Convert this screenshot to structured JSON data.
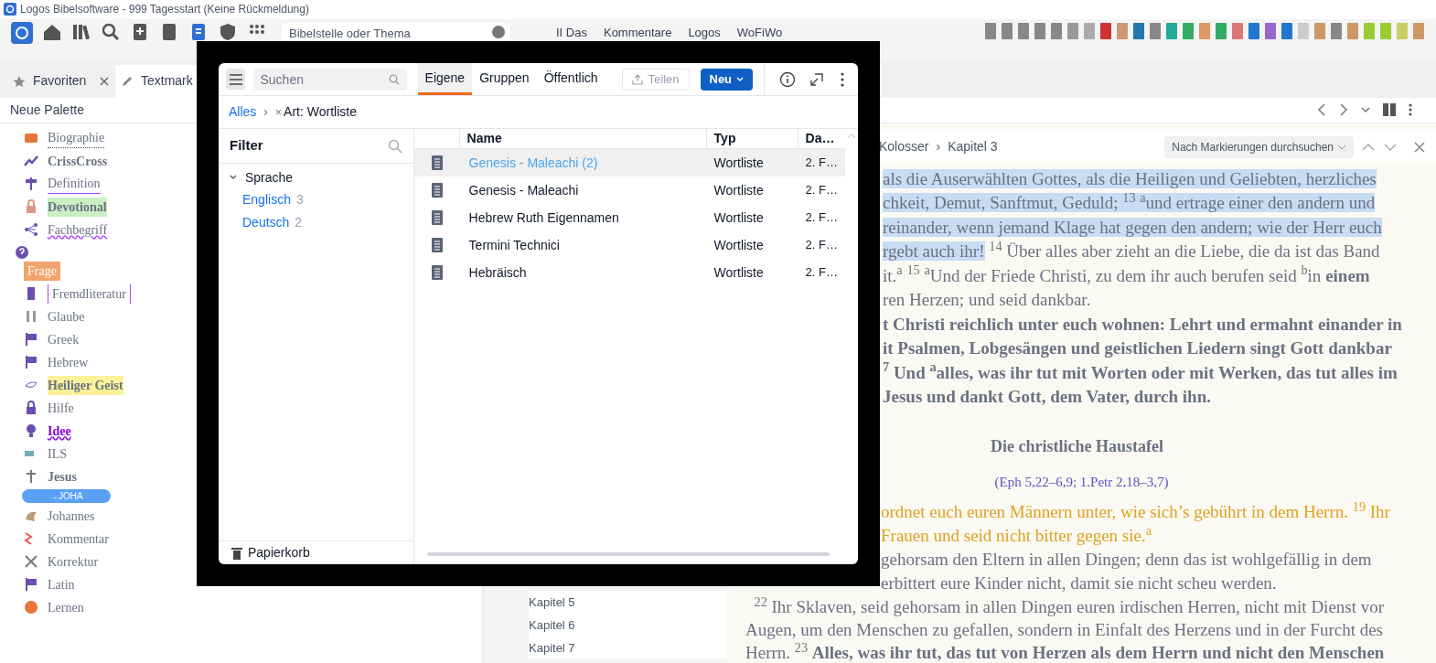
{
  "window": {
    "title": "Logos Bibelsoftware - 999 Tagesstart (Keine Rückmeldung)"
  },
  "toolbar": {
    "search": {
      "placeholder": "Bibelstelle oder Thema"
    },
    "menus": [
      "II Das",
      "Kommentare",
      "Logos",
      "WoFiWo"
    ]
  },
  "tabs": [
    {
      "label": "Favoriten",
      "closable": true
    },
    {
      "label": "Textmark",
      "closable": false
    }
  ],
  "palette": {
    "title": "Neue Palette",
    "items": [
      {
        "label": "Biographie",
        "kind": "dotted"
      },
      {
        "label": "CrissCross",
        "kind": "bold"
      },
      {
        "label": "Definition",
        "kind": "underline"
      },
      {
        "label": "Devotional",
        "kind": "highlight",
        "color": "#c9efc2"
      },
      {
        "label": "Fachbegriff",
        "kind": "wavy"
      },
      {
        "label": "Frage",
        "kind": "badge",
        "color": "#f3a46e"
      },
      {
        "label": "Fremdliteratur",
        "kind": "bracket"
      },
      {
        "label": "Glaube",
        "kind": "plain"
      },
      {
        "label": "Greek",
        "kind": "plain"
      },
      {
        "label": "Hebrew",
        "kind": "plain"
      },
      {
        "label": "Heiliger Geist",
        "kind": "highlight",
        "color": "#fbf29a"
      },
      {
        "label": "Hilfe",
        "kind": "plain"
      },
      {
        "label": "Idee",
        "kind": "link"
      },
      {
        "label": "ILS",
        "kind": "plain"
      },
      {
        "label": "Jesus",
        "kind": "bold"
      },
      {
        "label": "Johannes",
        "kind": "plain",
        "tag": "→JOHA"
      },
      {
        "label": "Kommentar",
        "kind": "plain"
      },
      {
        "label": "Korrektur",
        "kind": "plain"
      },
      {
        "label": "Latin",
        "kind": "plain"
      },
      {
        "label": "Lernen",
        "kind": "plain"
      }
    ]
  },
  "chapters": [
    "Kapitel 5",
    "Kapitel 6",
    "Kapitel 7"
  ],
  "reader": {
    "breadcrumb": [
      "Kolosser",
      "Kapitel 3"
    ],
    "breadcrumb_separator": "›",
    "search_dropdown": "Nach Markierungen durchsuchen",
    "upper_lines": [
      {
        "kind": "normal",
        "segments": [
          {
            "text": "als die Auserwählten Gottes, als die Heiligen und Geliebten, herzliches",
            "highlighted": true
          }
        ]
      },
      {
        "kind": "normal",
        "segments": [
          {
            "text": "chkeit, Demut, Sanftmut, Geduld; $^{13}$ $^{a}$und ertrage einer den andern und",
            "highlighted": true
          }
        ]
      },
      {
        "kind": "normal",
        "segments": [
          {
            "text": "reinander, wenn jemand Klage hat gegen den andern; wie der Herr euch",
            "highlighted": true
          }
        ]
      },
      {
        "kind": "normal",
        "segments": [
          {
            "text": "rgebt auch ihr!",
            "highlighted": true
          },
          {
            "text": " $^{14}$ Über alles aber zieht an die Liebe, die da ist das Band",
            "highlighted": false
          }
        ]
      },
      {
        "kind": "normal",
        "segments": [
          {
            "text": "it.$^{a}$ $^{15}$ $^{a}$Und der Friede Christi, zu dem ihr auch berufen seid $^{b}$in **einem**",
            "highlighted": false
          }
        ]
      },
      {
        "kind": "normal",
        "segments": [
          {
            "text": "ren Herzen; und seid dankbar.",
            "highlighted": false
          }
        ]
      },
      {
        "kind": "bold",
        "segments": [
          {
            "text": "t Christi reichlich unter euch wohnen: Lehrt und ermahnt einander in",
            "highlighted": false
          }
        ]
      },
      {
        "kind": "bold",
        "segments": [
          {
            "text": "it Psalmen, Lobgesängen und geistlichen Liedern singt Gott dankbar",
            "highlighted": false
          }
        ]
      },
      {
        "kind": "bold",
        "segments": [
          {
            "text": "$^{7}$ Und $^{a}$alles, was ihr tut mit Worten oder mit Werken, das tut alles im",
            "highlighted": false
          }
        ]
      },
      {
        "kind": "bold",
        "segments": [
          {
            "text": "Jesus und dankt Gott, dem Vater, durch ihn.",
            "highlighted": false
          }
        ]
      }
    ],
    "heading": "Die christliche Haustafel",
    "reference": "(Eph 5,22–6,9; 1.Petr 2,18–3,7)",
    "partial_lines": [
      {
        "kind": "accent",
        "text": "ordnet euch euren Männern unter, wie sich’s gebührt in dem Herrn. $^{19}$ Ihr"
      },
      {
        "kind": "accent",
        "text": "Frauen und seid nicht bitter gegen sie.$^{a}$"
      },
      {
        "kind": "normal",
        "text": "gehorsam den Eltern in allen Dingen; denn das ist wohlgefällig in dem"
      },
      {
        "kind": "normal",
        "text": "erbittert eure Kinder nicht, damit sie nicht scheu werden."
      }
    ],
    "lines": [
      "  $^{22}$ Ihr Sklaven, seid gehorsam in allen Dingen euren irdischen Herren, nicht mit Dienst vor",
      "Augen, um den Menschen zu gefallen, sondern in Einfalt des Herzens und in der Furcht des",
      "Herrn. $^{23}$ **Alles, was ihr tut, das tut von Herzen als dem Herrn und nicht den Menschen**"
    ]
  },
  "dialog": {
    "search": {
      "placeholder": "Suchen"
    },
    "tabs": [
      {
        "label": "Eigene",
        "selected": true
      },
      {
        "label": "Gruppen",
        "selected": false
      },
      {
        "label": "Öffentlich",
        "selected": false
      }
    ],
    "share_button": {
      "label": "Teilen",
      "disabled": true
    },
    "new_button": "Neu",
    "breadcrumb": {
      "root": "Alles",
      "separator": "›",
      "remove": "×",
      "filter": "Art: Wortliste"
    },
    "filter": {
      "title": "Filter",
      "groups": [
        {
          "label": "Sprache",
          "expanded": true,
          "children": [
            {
              "label": "Englisch",
              "count": "3"
            },
            {
              "label": "Deutsch",
              "count": "2"
            }
          ]
        }
      ]
    },
    "trash": "Papierkorb",
    "table": {
      "columns": [
        "Name",
        "Typ",
        "Da…"
      ],
      "rows": [
        {
          "name": "Genesis - Maleachi (2)",
          "type": "Wortliste",
          "date": "2. F…",
          "selected": true
        },
        {
          "name": "Genesis - Maleachi",
          "type": "Wortliste",
          "date": "2. F…",
          "selected": false
        },
        {
          "name": "Hebrew Ruth Eigennamen",
          "type": "Wortliste",
          "date": "2. F…",
          "selected": false
        },
        {
          "name": "Termini Technici",
          "type": "Wortliste",
          "date": "2. F…",
          "selected": false
        },
        {
          "name": "Hebräisch",
          "type": "Wortliste",
          "date": "2. F…",
          "selected": false
        }
      ]
    }
  }
}
